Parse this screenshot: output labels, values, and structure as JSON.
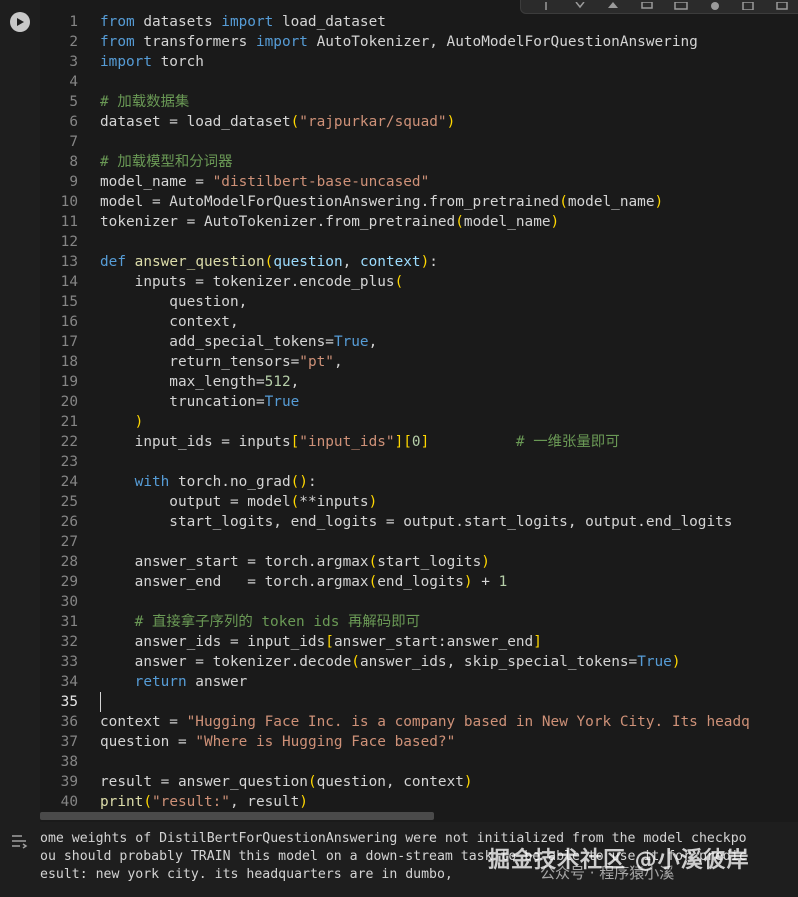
{
  "toolbar": {
    "icons": [
      "arrow-up-icon",
      "arrow-down-icon",
      "link-icon",
      "comment-icon",
      "settings-icon",
      "mirror-cell-icon",
      "delete-icon",
      "more-icon"
    ]
  },
  "editor": {
    "active_line": 35,
    "code_lines": [
      [
        [
          "kw",
          "from"
        ],
        [
          "code",
          " datasets "
        ],
        [
          "kw",
          "import"
        ],
        [
          "code",
          " load_dataset"
        ]
      ],
      [
        [
          "kw",
          "from"
        ],
        [
          "code",
          " transformers "
        ],
        [
          "kw",
          "import"
        ],
        [
          "code",
          " AutoTokenizer, AutoModelForQuestionAnswering"
        ]
      ],
      [
        [
          "kw",
          "import"
        ],
        [
          "code",
          " torch"
        ]
      ],
      [],
      [
        [
          "cm",
          "# 加载数据集"
        ]
      ],
      [
        [
          "code",
          "dataset = load_dataset"
        ],
        [
          "br",
          "("
        ],
        [
          "str",
          "\"rajpurkar/squad\""
        ],
        [
          "br",
          ")"
        ]
      ],
      [],
      [
        [
          "cm",
          "# 加载模型和分词器"
        ]
      ],
      [
        [
          "code",
          "model_name = "
        ],
        [
          "str",
          "\"distilbert-base-uncased\""
        ]
      ],
      [
        [
          "code",
          "model = AutoModelForQuestionAnswering.from_pretrained"
        ],
        [
          "br",
          "("
        ],
        [
          "code",
          "model_name"
        ],
        [
          "br",
          ")"
        ]
      ],
      [
        [
          "code",
          "tokenizer = AutoTokenizer.from_pretrained"
        ],
        [
          "br",
          "("
        ],
        [
          "code",
          "model_name"
        ],
        [
          "br",
          ")"
        ]
      ],
      [],
      [
        [
          "kw",
          "def"
        ],
        [
          "code",
          " "
        ],
        [
          "fn",
          "answer_question"
        ],
        [
          "br",
          "("
        ],
        [
          "param",
          "question"
        ],
        [
          "code",
          ", "
        ],
        [
          "param",
          "context"
        ],
        [
          "br",
          ")"
        ],
        [
          "code",
          ":"
        ]
      ],
      [
        [
          "code",
          "    inputs = tokenizer.encode_plus"
        ],
        [
          "br",
          "("
        ]
      ],
      [
        [
          "code",
          "        question,"
        ]
      ],
      [
        [
          "code",
          "        context,"
        ]
      ],
      [
        [
          "code",
          "        add_special_tokens="
        ],
        [
          "kw",
          "True"
        ],
        [
          "code",
          ","
        ]
      ],
      [
        [
          "code",
          "        return_tensors="
        ],
        [
          "str",
          "\"pt\""
        ],
        [
          "code",
          ","
        ]
      ],
      [
        [
          "code",
          "        max_length="
        ],
        [
          "num",
          "512"
        ],
        [
          "code",
          ","
        ]
      ],
      [
        [
          "code",
          "        truncation="
        ],
        [
          "kw",
          "True"
        ]
      ],
      [
        [
          "br",
          "    )"
        ]
      ],
      [
        [
          "code",
          "    input_ids = inputs"
        ],
        [
          "br",
          "["
        ],
        [
          "str",
          "\"input_ids\""
        ],
        [
          "br",
          "]["
        ],
        [
          "num",
          "0"
        ],
        [
          "br",
          "]"
        ],
        [
          "code",
          "          "
        ],
        [
          "cm",
          "# 一维张量即可"
        ]
      ],
      [],
      [
        [
          "code",
          "    "
        ],
        [
          "kw",
          "with"
        ],
        [
          "code",
          " torch.no_grad"
        ],
        [
          "br",
          "()"
        ],
        [
          "code",
          ":"
        ]
      ],
      [
        [
          "code",
          "        output = model"
        ],
        [
          "br",
          "("
        ],
        [
          "code",
          "**inputs"
        ],
        [
          "br",
          ")"
        ]
      ],
      [
        [
          "code",
          "        start_logits, end_logits = output.start_logits, output.end_logits"
        ]
      ],
      [],
      [
        [
          "code",
          "    answer_start = torch.argmax"
        ],
        [
          "br",
          "("
        ],
        [
          "code",
          "start_logits"
        ],
        [
          "br",
          ")"
        ]
      ],
      [
        [
          "code",
          "    answer_end   = torch.argmax"
        ],
        [
          "br",
          "("
        ],
        [
          "code",
          "end_logits"
        ],
        [
          "br",
          ")"
        ],
        [
          "code",
          " + "
        ],
        [
          "num",
          "1"
        ]
      ],
      [],
      [
        [
          "code",
          "    "
        ],
        [
          "cm",
          "# 直接拿子序列的 token ids 再解码即可"
        ]
      ],
      [
        [
          "code",
          "    answer_ids = input_ids"
        ],
        [
          "br",
          "["
        ],
        [
          "code",
          "answer_start:answer_end"
        ],
        [
          "br",
          "]"
        ]
      ],
      [
        [
          "code",
          "    answer = tokenizer.decode"
        ],
        [
          "br",
          "("
        ],
        [
          "code",
          "answer_ids, skip_special_tokens="
        ],
        [
          "kw",
          "True"
        ],
        [
          "br",
          ")"
        ]
      ],
      [
        [
          "code",
          "    "
        ],
        [
          "kw",
          "return"
        ],
        [
          "code",
          " answer"
        ]
      ],
      [],
      [
        [
          "code",
          "context = "
        ],
        [
          "str",
          "\"Hugging Face Inc. is a company based in New York City. Its headq"
        ]
      ],
      [
        [
          "code",
          "question = "
        ],
        [
          "str",
          "\"Where is Hugging Face based?\""
        ]
      ],
      [],
      [
        [
          "code",
          "result = answer_question"
        ],
        [
          "br",
          "("
        ],
        [
          "code",
          "question, context"
        ],
        [
          "br",
          ")"
        ]
      ],
      [
        [
          "fn",
          "print"
        ],
        [
          "br",
          "("
        ],
        [
          "str",
          "\"result:\""
        ],
        [
          "code",
          ", result"
        ],
        [
          "br",
          ")"
        ]
      ]
    ]
  },
  "output": {
    "lines": [
      "ome weights of DistilBertForQuestionAnswering were not initialized from the model checkpo",
      "ou should probably TRAIN this model on a down-stream task to be able to use it for predic",
      "esult: new york city. its headquarters are in dumbo,"
    ]
  },
  "watermark": {
    "line1": "掘金技术社区 @小溪彼岸",
    "line2": "公众号 · 程序猿小溪"
  },
  "colors": {
    "keyword": "#569cd6",
    "string": "#ce9178",
    "comment": "#6a9955",
    "parameter": "#9cdcfe",
    "function": "#dcdcaa",
    "number": "#b5cea8",
    "bracket": "#ffd700",
    "text": "#d4d4d4",
    "background": "#1a1a1a"
  }
}
